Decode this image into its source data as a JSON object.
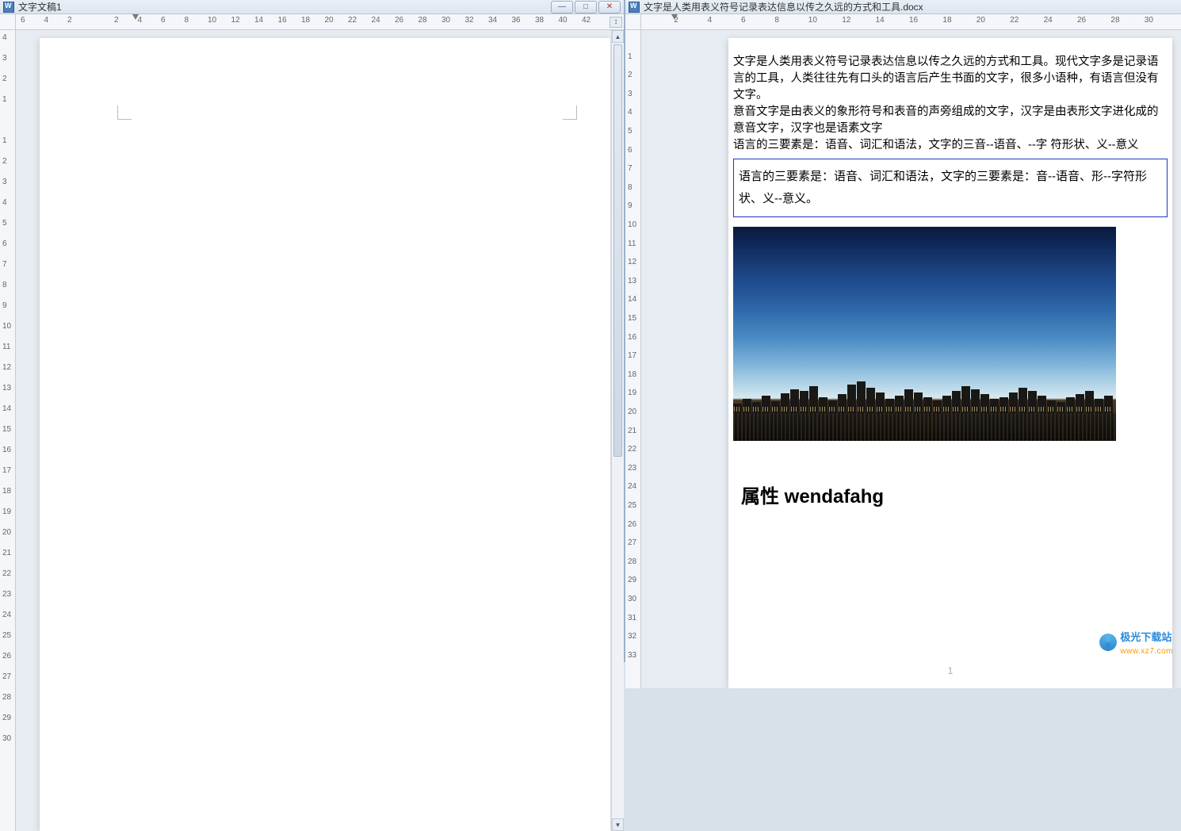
{
  "left": {
    "title": "文字文稿1",
    "win_buttons": {
      "min": "—",
      "max": "□",
      "close": "✕"
    },
    "hruler": [
      "6",
      "4",
      "2",
      "",
      "2",
      "4",
      "6",
      "8",
      "10",
      "12",
      "14",
      "16",
      "18",
      "20",
      "22",
      "24",
      "26",
      "28",
      "30",
      "32",
      "34",
      "36",
      "38",
      "40",
      "42"
    ],
    "vruler": [
      "4",
      "3",
      "2",
      "1",
      "",
      "1",
      "2",
      "3",
      "4",
      "5",
      "6",
      "7",
      "8",
      "9",
      "10",
      "11",
      "12",
      "13",
      "14",
      "15",
      "16",
      "17",
      "18",
      "19",
      "20",
      "21",
      "22",
      "23",
      "24",
      "25",
      "26",
      "27",
      "28",
      "29",
      "30"
    ],
    "ruler_btn": "↕"
  },
  "right": {
    "title": "文字是人类用表义符号记录表达信息以传之久远的方式和工具.docx",
    "hruler": [
      "",
      "2",
      "",
      "4",
      "",
      "6",
      "",
      "8",
      "",
      "10",
      "",
      "12",
      "",
      "14",
      "",
      "16",
      "",
      "18",
      "",
      "20",
      "",
      "22",
      "",
      "24",
      "",
      "26",
      "",
      "28",
      "",
      "30"
    ],
    "vruler": [
      "",
      "1",
      "2",
      "3",
      "4",
      "5",
      "6",
      "7",
      "8",
      "9",
      "10",
      "11",
      "12",
      "13",
      "14",
      "15",
      "16",
      "17",
      "18",
      "19",
      "20",
      "21",
      "22",
      "23",
      "24",
      "25",
      "26",
      "27",
      "28",
      "29",
      "30",
      "31",
      "32",
      "33"
    ],
    "body": {
      "p1": "文字是人类用表义符号记录表达信息以传之久远的方式和工具。现代文字多是记录语言的工具，人类往往先有口头的语言后产生书面的文字，很多小语种，有语言但没有文字。",
      "p2": "意音文字是由表义的象形符号和表音的声旁组成的文字，汉字是由表形文字进化成的意音文字，汉字也是语素文字",
      "p3": "语言的三要素是：语音、词汇和语法，文字的三音--语音、--字 符形状、义--意义",
      "boxed": "语言的三要素是：语音、词汇和语法，文字的三要素是：音--语音、形--字符形状、义--意义。",
      "heading": "属性 wendafahg",
      "page_number": "1"
    }
  },
  "skyline": [
    12,
    18,
    14,
    22,
    15,
    25,
    30,
    28,
    34,
    20,
    16,
    24,
    36,
    40,
    32,
    26,
    18,
    22,
    30,
    26,
    20,
    16,
    22,
    28,
    34,
    30,
    24,
    18,
    20,
    26,
    32,
    28,
    22,
    16,
    14,
    20,
    24,
    28,
    18,
    22
  ],
  "watermark": {
    "name": "极光下载站",
    "url": "www.xz7.com"
  }
}
